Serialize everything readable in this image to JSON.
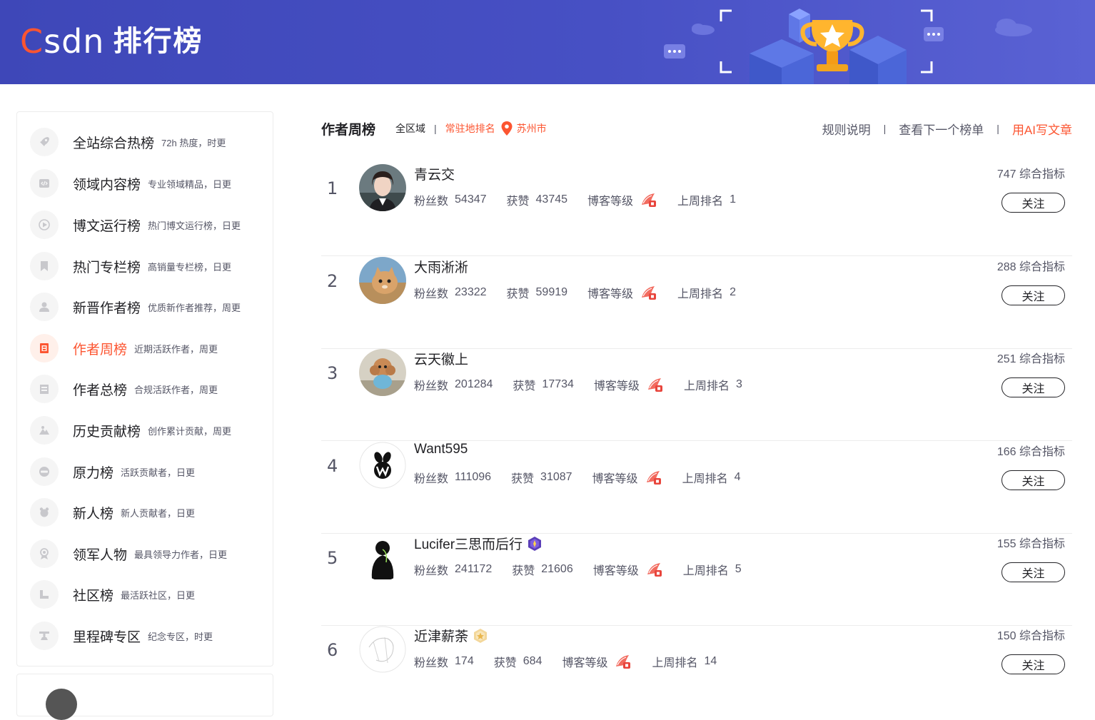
{
  "header": {
    "logo_prefix": "C",
    "logo_rest": "SDN",
    "title": "排行榜"
  },
  "sidebar": {
    "items": [
      {
        "label": "全站综合热榜",
        "desc": "72h 热度，时更",
        "icon": "rocket-icon",
        "active": false
      },
      {
        "label": "领域内容榜",
        "desc": "专业领域精品，日更",
        "icon": "code-icon",
        "active": false
      },
      {
        "label": "博文运行榜",
        "desc": "热门博文运行榜，日更",
        "icon": "play-icon",
        "active": false
      },
      {
        "label": "热门专栏榜",
        "desc": "高销量专栏榜，日更",
        "icon": "bookmark-icon",
        "active": false
      },
      {
        "label": "新晋作者榜",
        "desc": "优质新作者推荐，周更",
        "icon": "user-icon",
        "active": false
      },
      {
        "label": "作者周榜",
        "desc": "近期活跃作者，周更",
        "icon": "calendar-week-icon",
        "active": true
      },
      {
        "label": "作者总榜",
        "desc": "合规活跃作者，周更",
        "icon": "total-icon",
        "active": false
      },
      {
        "label": "历史贡献榜",
        "desc": "创作累计贡献，周更",
        "icon": "history-icon",
        "active": false
      },
      {
        "label": "原力榜",
        "desc": "活跃贡献者，日更",
        "icon": "new-badge-icon",
        "active": false
      },
      {
        "label": "新人榜",
        "desc": "新人贡献者，日更",
        "icon": "newbie-icon",
        "active": false
      },
      {
        "label": "领军人物",
        "desc": "最具领导力作者，日更",
        "icon": "medal-icon",
        "active": false
      },
      {
        "label": "社区榜",
        "desc": "最活跃社区，日更",
        "icon": "community-icon",
        "active": false
      },
      {
        "label": "里程碑专区",
        "desc": "纪念专区，时更",
        "icon": "milestone-icon",
        "active": false
      }
    ]
  },
  "toolbar": {
    "board_title": "作者周榜",
    "region": "全区域",
    "separator": "|",
    "resident_rank": "常驻地排名",
    "city": "苏州市",
    "rules": "规则说明",
    "next_board": "查看下一个榜单",
    "ai_write": "用AI写文章"
  },
  "labels": {
    "fans": "粉丝数",
    "likes": "获赞",
    "blog_level": "博客等级",
    "last_week_rank": "上周排名",
    "score_suffix": "综合指标",
    "follow": "关注"
  },
  "rows": [
    {
      "rank": "1",
      "name": "青云交",
      "fans": "54347",
      "likes": "43745",
      "last_rank": "1",
      "score": "747",
      "badge": ""
    },
    {
      "rank": "2",
      "name": "大雨淅淅",
      "fans": "23322",
      "likes": "59919",
      "last_rank": "2",
      "score": "288",
      "badge": ""
    },
    {
      "rank": "3",
      "name": "云天徽上",
      "fans": "201284",
      "likes": "17734",
      "last_rank": "3",
      "score": "251",
      "badge": ""
    },
    {
      "rank": "4",
      "name": "Want595",
      "fans": "111096",
      "likes": "31087",
      "last_rank": "4",
      "score": "166",
      "badge": ""
    },
    {
      "rank": "5",
      "name": "Lucifer三思而后行",
      "fans": "241172",
      "likes": "21606",
      "last_rank": "5",
      "score": "155",
      "badge": "purple-hexagon-badge-icon"
    },
    {
      "rank": "6",
      "name": "近津薪荼",
      "fans": "174",
      "likes": "684",
      "last_rank": "14",
      "score": "150",
      "badge": "gold-hexagon-badge-icon"
    }
  ],
  "colors": {
    "accent": "#fc5531",
    "header_bg": "#4750c4",
    "text_primary": "#222226",
    "text_secondary": "#555666"
  }
}
